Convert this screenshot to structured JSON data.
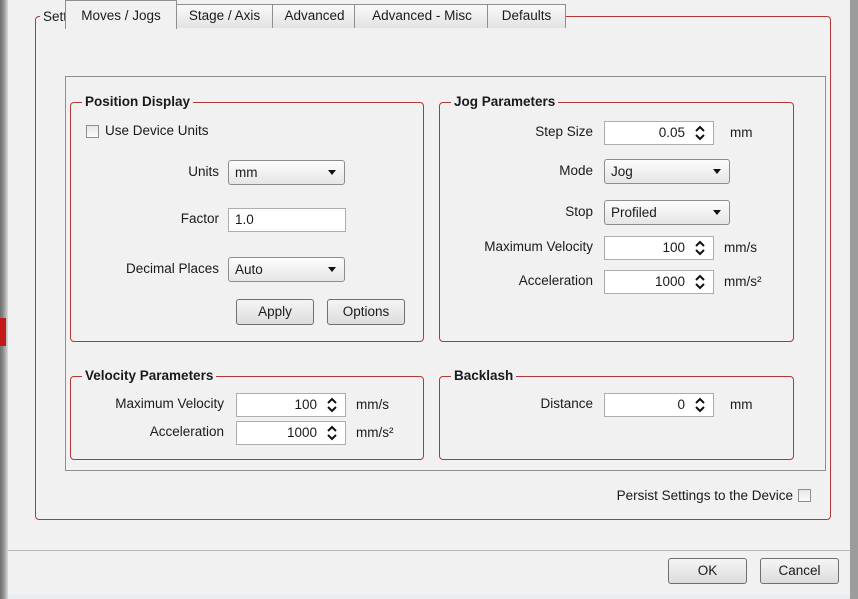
{
  "settings_title": "Settings",
  "tabs": [
    {
      "label": "Moves / Jogs",
      "active": true
    },
    {
      "label": "Stage / Axis",
      "active": false
    },
    {
      "label": "Advanced",
      "active": false
    },
    {
      "label": "Advanced - Misc",
      "active": false
    },
    {
      "label": "Defaults",
      "active": false
    }
  ],
  "position_display": {
    "title": "Position Display",
    "use_device_units_label": "Use Device Units",
    "use_device_units_checked": false,
    "units_label": "Units",
    "units_value": "mm",
    "factor_label": "Factor",
    "factor_value": "1.0",
    "decimal_places_label": "Decimal Places",
    "decimal_places_value": "Auto",
    "apply_label": "Apply",
    "options_label": "Options"
  },
  "jog_parameters": {
    "title": "Jog Parameters",
    "step_size_label": "Step Size",
    "step_size_value": "0.05",
    "step_size_unit": "mm",
    "mode_label": "Mode",
    "mode_value": "Jog",
    "stop_label": "Stop",
    "stop_value": "Profiled",
    "max_velocity_label": "Maximum Velocity",
    "max_velocity_value": "100",
    "max_velocity_unit": "mm/s",
    "acceleration_label": "Acceleration",
    "acceleration_value": "1000",
    "acceleration_unit": "mm/s²"
  },
  "velocity_parameters": {
    "title": "Velocity Parameters",
    "max_velocity_label": "Maximum Velocity",
    "max_velocity_value": "100",
    "max_velocity_unit": "mm/s",
    "acceleration_label": "Acceleration",
    "acceleration_value": "1000",
    "acceleration_unit": "mm/s²"
  },
  "backlash": {
    "title": "Backlash",
    "distance_label": "Distance",
    "distance_value": "0",
    "distance_unit": "mm"
  },
  "persist_label": "Persist Settings to the Device",
  "persist_checked": false,
  "ok_label": "OK",
  "cancel_label": "Cancel",
  "colors": {
    "group_border": "#b3363b",
    "dialog_bg": "#f1f1f1"
  }
}
